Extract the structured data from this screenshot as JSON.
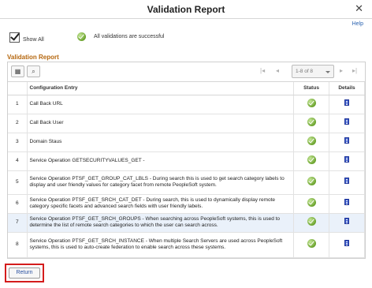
{
  "window": {
    "title": "Validation Report"
  },
  "help_link": "Help",
  "show_all": {
    "label": "Show All",
    "checked": true
  },
  "status_message": "All validations are successful",
  "section_title": "Validation Report",
  "grid": {
    "pager_text": "1-8 of 8",
    "columns": {
      "num": "",
      "entry": "Configuration Entry",
      "status": "Status",
      "details": "Details"
    },
    "rows": [
      {
        "num": "1",
        "entry": "Call Back URL"
      },
      {
        "num": "2",
        "entry": "Call Back User"
      },
      {
        "num": "3",
        "entry": "Domain Staus"
      },
      {
        "num": "4",
        "entry": "Service Operation GETSECURITYVALUES_GET -"
      },
      {
        "num": "5",
        "entry": "Service Operation PTSF_GET_GROUP_CAT_LBLS - During search this is used to get search category labels to display and user friendly values for category facet from remote PeopleSoft system."
      },
      {
        "num": "6",
        "entry": "Service Operation PTSF_GET_SRCH_CAT_DET - During search, this is used to dynamically display remote category specific facets and advanced search fields with user friendly labels."
      },
      {
        "num": "7",
        "entry": "Service Operation PTSF_GET_SRCH_GROUPS - When searching across PeopleSoft systems, this is used to determine the list of remote search categories to which the user can search across."
      },
      {
        "num": "8",
        "entry": "Service Operation PTSF_GET_SRCH_INSTANCE - When multiple Search Servers are used across PeopleSoft systems, this is used to auto-create federation to enable search across these systems."
      }
    ]
  },
  "return_button": "Return",
  "icons": {
    "status": "green-check-icon",
    "details": "details-page-icon"
  },
  "colors": {
    "section_title": "#b5660d",
    "link": "#2a62b0",
    "highlight_border": "#d41c1c"
  }
}
